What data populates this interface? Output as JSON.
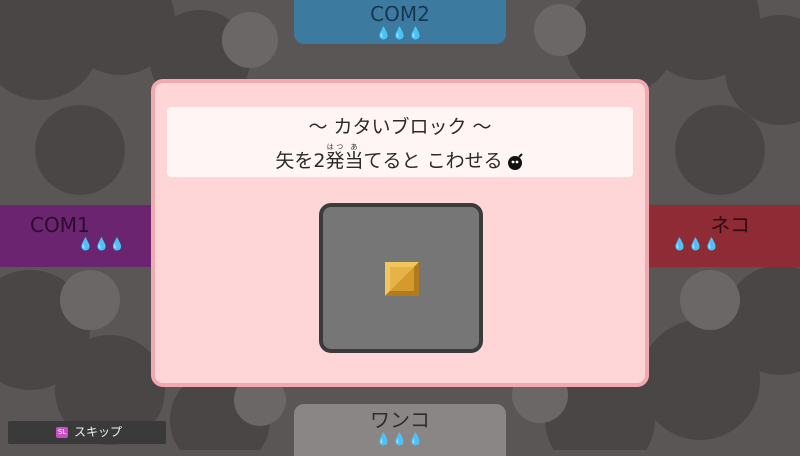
{
  "players": {
    "top": {
      "name": "COM2",
      "lives": "💧💧💧"
    },
    "left": {
      "name": "COM1",
      "lives": "💧💧💧"
    },
    "right": {
      "name": "ネコ",
      "lives": "💧💧💧"
    },
    "bottom": {
      "name": "ワンコ",
      "lives": "💧💧💧"
    }
  },
  "dialog": {
    "title": "～ カタいブロック ～",
    "desc_part1": "矢を2",
    "desc_ruby_base": "発",
    "desc_ruby_text": "はつ",
    "desc_ruby2_base": "当",
    "desc_ruby2_text": "あ",
    "desc_part2": "てると こわせる"
  },
  "skip": {
    "key": "SL",
    "label": "スキップ"
  },
  "colors": {
    "dialog_bg": "#ffd6d8",
    "dialog_border": "#f2a9b0",
    "block_gold": "#c8922a"
  }
}
